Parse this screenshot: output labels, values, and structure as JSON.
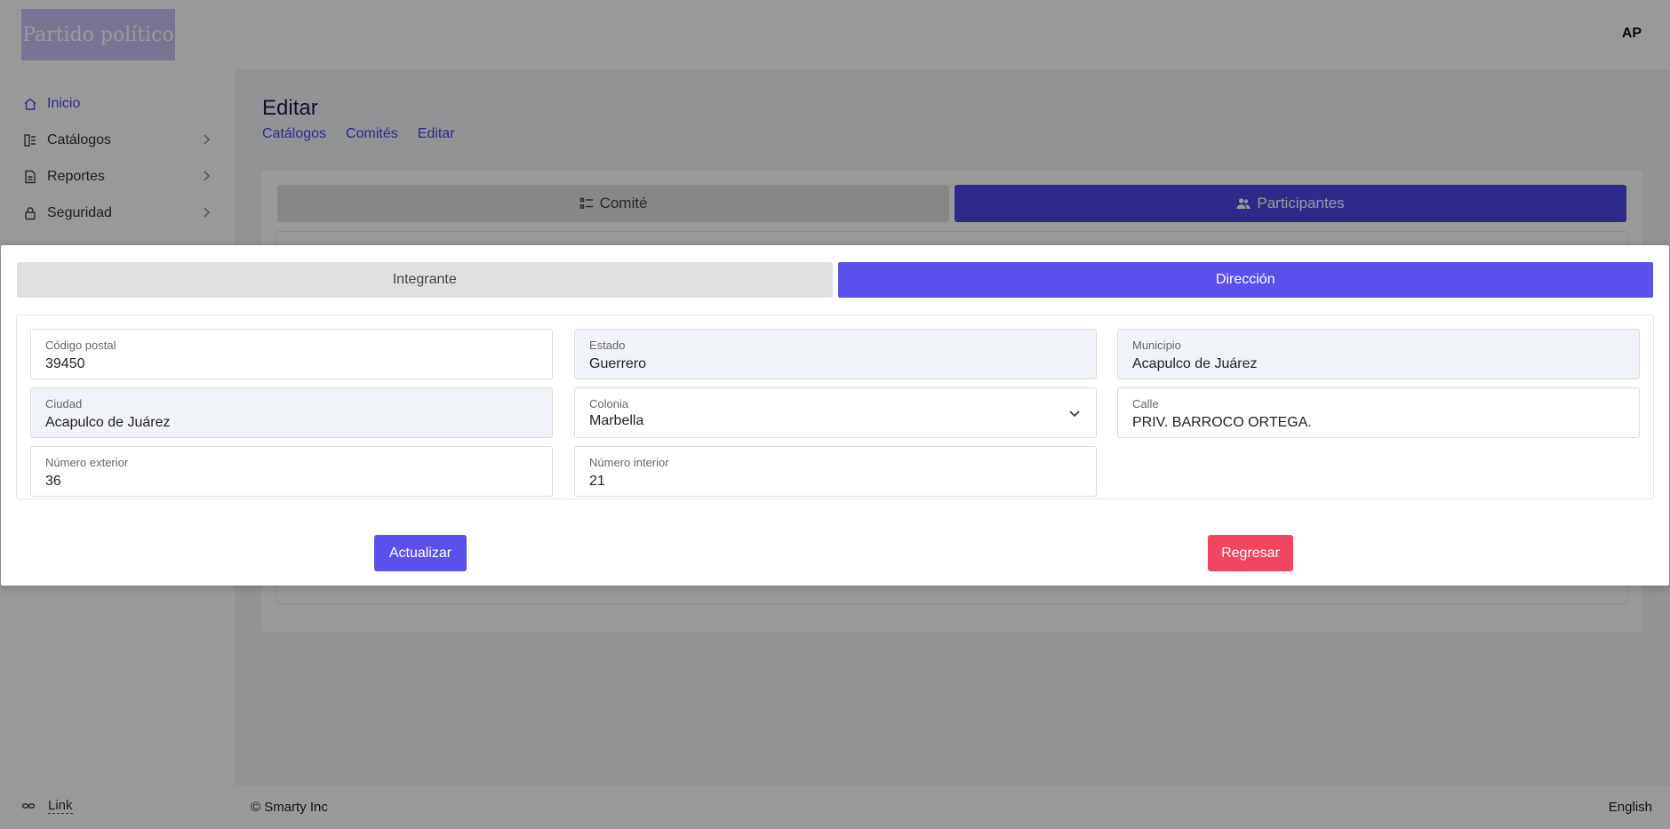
{
  "app": {
    "logo_text": "Partido político",
    "user_initials": "AP"
  },
  "sidebar": {
    "items": [
      {
        "label": "Inicio",
        "icon": "home-icon",
        "active": true
      },
      {
        "label": "Catálogos",
        "icon": "catalog-icon",
        "active": false
      },
      {
        "label": "Reportes",
        "icon": "report-icon",
        "active": false
      },
      {
        "label": "Seguridad",
        "icon": "lock-icon",
        "active": false
      }
    ],
    "footer_link": "Link"
  },
  "page": {
    "title": "Editar",
    "breadcrumb": [
      "Catálogos",
      "Comités",
      "Editar"
    ]
  },
  "outer_tabs": [
    {
      "label": "Comité",
      "icon": "list-icon",
      "active": false
    },
    {
      "label": "Participantes",
      "icon": "users-icon",
      "active": true
    }
  ],
  "modal": {
    "tabs": [
      {
        "label": "Integrante",
        "active": false
      },
      {
        "label": "Dirección",
        "active": true
      }
    ],
    "fields": {
      "codigo_postal": {
        "label": "Código postal",
        "value": "39450"
      },
      "estado": {
        "label": "Estado",
        "value": "Guerrero"
      },
      "municipio": {
        "label": "Municipio",
        "value": "Acapulco de Juárez"
      },
      "ciudad": {
        "label": "Ciudad",
        "value": "Acapulco de Juárez"
      },
      "colonia": {
        "label": "Colonia",
        "value": "Marbella"
      },
      "calle": {
        "label": "Calle",
        "value": "PRIV. BARROCO ORTEGA."
      },
      "numero_exterior": {
        "label": "Número exterior",
        "value": "36"
      },
      "numero_interior": {
        "label": "Número interior",
        "value": "21"
      }
    },
    "actions": {
      "update": "Actualizar",
      "back": "Regresar"
    }
  },
  "footer": {
    "copyright": "© Smarty Inc",
    "language": "English"
  },
  "colors": {
    "accent": "#4f46e5",
    "accent_modal": "#5b50ec",
    "danger": "#f2455f",
    "logo_bg": "#c9c4f3"
  }
}
